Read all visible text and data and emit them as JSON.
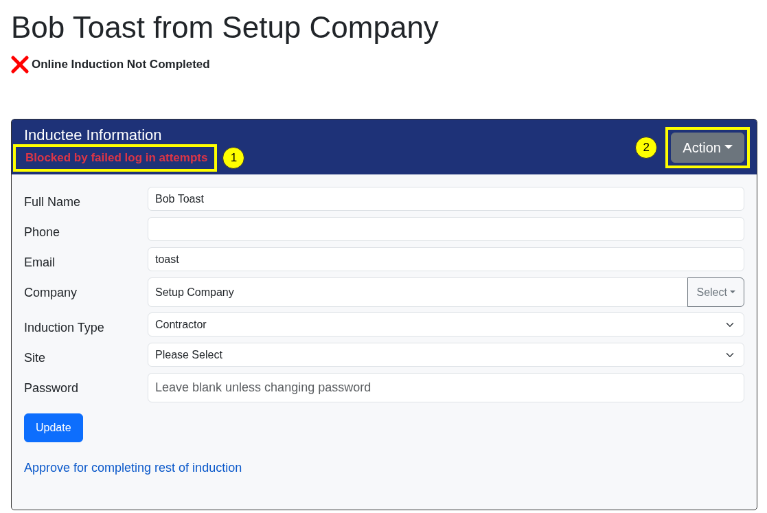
{
  "title": "Bob Toast from Setup Company",
  "induction_status": {
    "completed": false,
    "text": "Online Induction Not Completed"
  },
  "card": {
    "title": "Inductee Information",
    "status": {
      "text": "Blocked by failed log in attempts",
      "highlighted": true,
      "callout": "1"
    },
    "action": {
      "label": "Action",
      "highlighted": true,
      "callout": "2"
    },
    "fields": [
      {
        "label": "Full Name",
        "kind": "text",
        "value": "Bob Toast"
      },
      {
        "label": "Phone",
        "kind": "text"
      },
      {
        "label": "Email",
        "kind": "text",
        "value": "toast"
      },
      {
        "label": "Company",
        "kind": "picker",
        "value": "Setup Company",
        "button": "Select"
      },
      {
        "label": "Induction Type",
        "kind": "select",
        "value": "Contractor"
      },
      {
        "label": "Site",
        "kind": "select",
        "value": "Please Select"
      },
      {
        "label": "Password",
        "kind": "password",
        "placeholder": "Leave blank unless changing password"
      }
    ],
    "submit": "Update",
    "link": "Approve for completing rest of induction"
  }
}
